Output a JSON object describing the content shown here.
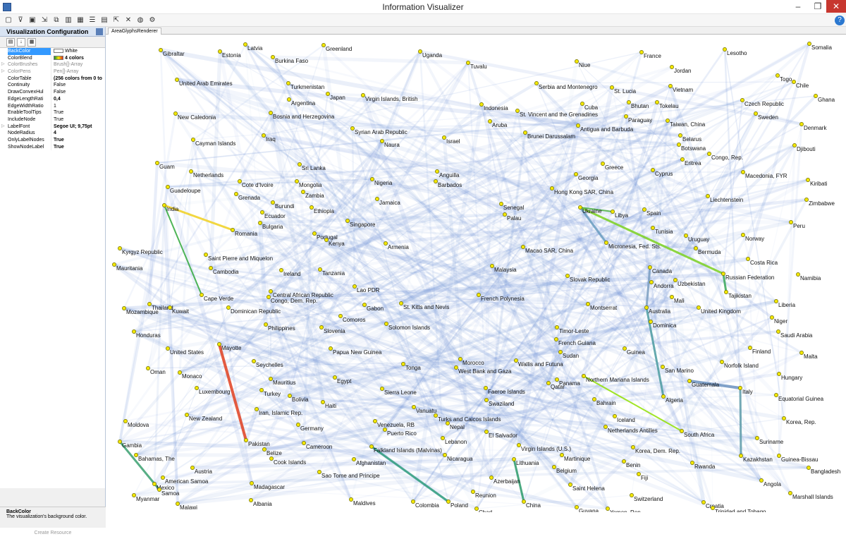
{
  "window": {
    "title": "Information Visualizer",
    "minimize": "–",
    "maximize": "❐",
    "close": "✕"
  },
  "toolbar": {
    "icons": [
      "new-icon",
      "filter-icon",
      "save-icon",
      "import-icon",
      "copy-icon",
      "chart-icon",
      "grid-icon",
      "list-icon",
      "layout-icon",
      "export-icon",
      "delete-icon",
      "globe-icon",
      "settings-icon",
      "help-icon"
    ]
  },
  "panel": {
    "title": "Visualization Configuration",
    "properties": [
      {
        "name": "BackColor",
        "value": "White",
        "swatch": "#ffffff",
        "selected": true
      },
      {
        "name": "ColorBlend",
        "value": "4 colors",
        "swatch": "gradient",
        "bold": true
      },
      {
        "name": "ColorBrushes",
        "value": "Brush[]-Array",
        "expander": true,
        "greyed": true
      },
      {
        "name": "ColorPens",
        "value": "Pen[]-Array",
        "expander": true,
        "greyed": true
      },
      {
        "name": "ColorTable",
        "value": "(256 colors from 0 to",
        "bold": true
      },
      {
        "name": "Continuity",
        "value": "False"
      },
      {
        "name": "DrawConvexHul",
        "value": "False"
      },
      {
        "name": "EdgeLengthRati",
        "value": "0,4",
        "bold": true
      },
      {
        "name": "EdgeWidthRatio",
        "value": "1"
      },
      {
        "name": "EnableToolTips",
        "value": "True"
      },
      {
        "name": "IncludeNode",
        "value": "True"
      },
      {
        "name": "LabelFont",
        "value": "Segoe UI; 9,75pt",
        "expander": true,
        "bold": true
      },
      {
        "name": "NodeRadius",
        "value": "4",
        "bold": true
      },
      {
        "name": "OnlyLabelNodes",
        "value": "True",
        "bold": true
      },
      {
        "name": "ShowNodeLabel",
        "value": "True",
        "bold": true
      }
    ],
    "help_title": "BackColor",
    "help_text": "The visualization's background color.",
    "create_button": "Create Resource"
  },
  "tab": {
    "label": "AreaGlyphsRenderer"
  },
  "nodes": [
    [
      "Gibraltar",
      228,
      71
    ],
    [
      "Latvia",
      348,
      63
    ],
    [
      "Estonia",
      312,
      73
    ],
    [
      "Burkina Faso",
      387,
      81
    ],
    [
      "Greenland",
      459,
      64
    ],
    [
      "Uganda",
      596,
      73
    ],
    [
      "Tuvalu",
      664,
      89
    ],
    [
      "Niue",
      818,
      87
    ],
    [
      "France",
      910,
      74
    ],
    [
      "Lesotho",
      1028,
      70
    ],
    [
      "Somalia",
      1148,
      62
    ],
    [
      "United Arab Emirates",
      251,
      113
    ],
    [
      "Turkmenistan",
      409,
      118
    ],
    [
      "Japan",
      465,
      133
    ],
    [
      "Virgin Islands, British",
      515,
      135
    ],
    [
      "Jordan",
      953,
      95
    ],
    [
      "Serbia and Montenegro",
      761,
      118
    ],
    [
      "St. Lucia",
      868,
      124
    ],
    [
      "Vietnam",
      951,
      122
    ],
    [
      "Togo",
      1103,
      107
    ],
    [
      "Chile",
      1126,
      116
    ],
    [
      "Ghana",
      1157,
      136
    ],
    [
      "Argentina",
      410,
      141
    ],
    [
      "Indonesia",
      683,
      148
    ],
    [
      "Cuba",
      826,
      147
    ],
    [
      "Bhutan",
      892,
      145
    ],
    [
      "Tokelau",
      932,
      145
    ],
    [
      "Czech Republic",
      1053,
      142
    ],
    [
      "Sweden",
      1072,
      161
    ],
    [
      "New Caledonia",
      249,
      161
    ],
    [
      "Bosnia and Herzegovina",
      384,
      160
    ],
    [
      "St. Vincent and the Grenadines",
      734,
      157
    ],
    [
      "Paraguay",
      888,
      165
    ],
    [
      "Taiwan, China",
      947,
      171
    ],
    [
      "Denmark",
      1137,
      176
    ],
    [
      "Syrian Arab Republic",
      500,
      182
    ],
    [
      "Aruba",
      695,
      172
    ],
    [
      "Antigua and Barbuda",
      820,
      178
    ],
    [
      "Brunei Darussalam",
      745,
      188
    ],
    [
      "Belarus",
      965,
      192
    ],
    [
      "Botswana",
      963,
      205
    ],
    [
      "Djibouti",
      1127,
      206
    ],
    [
      "Cayman Islands",
      274,
      198
    ],
    [
      "Iraq",
      374,
      192
    ],
    [
      "Naura",
      542,
      200
    ],
    [
      "Israel",
      630,
      195
    ],
    [
      "Congo, Rep.",
      1006,
      218
    ],
    [
      "Guam",
      223,
      231
    ],
    [
      "Sri Lanka",
      425,
      233
    ],
    [
      "Greece",
      855,
      232
    ],
    [
      "Eritrea",
      968,
      226
    ],
    [
      "Cyprus",
      926,
      241
    ],
    [
      "Netherlands",
      271,
      243
    ],
    [
      "Anguilla",
      620,
      243
    ],
    [
      "Georgia",
      817,
      247
    ],
    [
      "Macedonia, FYR",
      1054,
      244
    ],
    [
      "Kiribati",
      1146,
      255
    ],
    [
      "Cote d'Ivoire",
      340,
      257
    ],
    [
      "Mongolia",
      421,
      257
    ],
    [
      "Nigeria",
      528,
      254
    ],
    [
      "Barbados",
      618,
      257
    ],
    [
      "Guadeloupe",
      238,
      265
    ],
    [
      "Hong Kong SAR, China",
      783,
      267
    ],
    [
      "Zambia",
      430,
      272
    ],
    [
      "Grenada",
      335,
      275
    ],
    [
      "Jamaica",
      535,
      282
    ],
    [
      "Liechtenstein",
      1004,
      278
    ],
    [
      "Zimbabwe",
      1144,
      283
    ],
    [
      "India",
      233,
      291
    ],
    [
      "Burundi",
      387,
      287
    ],
    [
      "Ethiopia",
      442,
      294
    ],
    [
      "Senegal",
      711,
      289
    ],
    [
      "Ukraine",
      823,
      294
    ],
    [
      "Libya",
      869,
      300
    ],
    [
      "Spain",
      914,
      297
    ],
    [
      "Ecuador",
      372,
      301
    ],
    [
      "Palau",
      716,
      304
    ],
    [
      "Bulgaria",
      369,
      316
    ],
    [
      "Singapore",
      493,
      313
    ],
    [
      "Peru",
      1122,
      315
    ],
    [
      "Romania",
      330,
      326
    ],
    [
      "Portugal",
      446,
      331
    ],
    [
      "Tunisia",
      926,
      323
    ],
    [
      "Uruguay",
      973,
      334
    ],
    [
      "Norway",
      1054,
      333
    ],
    [
      "Kenya",
      463,
      340
    ],
    [
      "Armenia",
      547,
      345
    ],
    [
      "Micronesia, Fed. Sts.",
      860,
      344
    ],
    [
      "Bermuda",
      987,
      352
    ],
    [
      "Macao SAR, China",
      742,
      350
    ],
    [
      "Kyrgyz Republic",
      170,
      352
    ],
    [
      "Saint Pierre and Miquelon",
      292,
      361
    ],
    [
      "Costa Rica",
      1061,
      367
    ],
    [
      "Mauritania",
      162,
      375
    ],
    [
      "Cambodia",
      299,
      380
    ],
    [
      "Ireland",
      399,
      383
    ],
    [
      "Tanzania",
      454,
      382
    ],
    [
      "Malaysia",
      698,
      377
    ],
    [
      "Canada",
      922,
      379
    ],
    [
      "Russian Federation",
      1026,
      388
    ],
    [
      "Namibia",
      1132,
      389
    ],
    [
      "Slovak Republic",
      805,
      391
    ],
    [
      "Andorra",
      924,
      400
    ],
    [
      "Uzbekistan",
      958,
      397
    ],
    [
      "Lao PDR",
      503,
      406
    ],
    [
      "Tajikistan",
      1030,
      414
    ],
    [
      "Cape Verde",
      286,
      418
    ],
    [
      "Central African Republic",
      384,
      413
    ],
    [
      "Congo, Dem. Rep.",
      381,
      421
    ],
    [
      "French Polynesia",
      679,
      418
    ],
    [
      "Mali",
      953,
      421
    ],
    [
      "Liberia",
      1101,
      427
    ],
    [
      "Thailand",
      212,
      431
    ],
    [
      "Mozambique",
      176,
      437
    ],
    [
      "Kuwait",
      241,
      436
    ],
    [
      "Dominican Republic",
      324,
      436
    ],
    [
      "Gabon",
      517,
      432
    ],
    [
      "St. Kitts and Nevis",
      569,
      430
    ],
    [
      "Montserrat",
      834,
      431
    ],
    [
      "Australia",
      917,
      436
    ],
    [
      "United Kingdom",
      991,
      436
    ],
    [
      "Comoros",
      483,
      448
    ],
    [
      "Niger",
      1095,
      450
    ],
    [
      "Dominica",
      923,
      456
    ],
    [
      "Honduras",
      190,
      470
    ],
    [
      "Philippines",
      377,
      460
    ],
    [
      "Slovenia",
      456,
      464
    ],
    [
      "Solomon Islands",
      548,
      459
    ],
    [
      "Saudi Arabia",
      1104,
      470
    ],
    [
      "Timor-Leste",
      790,
      464
    ],
    [
      "French Guiana",
      789,
      481
    ],
    [
      "Mayotte",
      311,
      488
    ],
    [
      "United States",
      238,
      494
    ],
    [
      "Papua New Guinea",
      469,
      494
    ],
    [
      "Finland",
      1064,
      493
    ],
    [
      "Sudan",
      795,
      499
    ],
    [
      "Guinea",
      886,
      494
    ],
    [
      "Malta",
      1137,
      500
    ],
    [
      "Seychelles",
      360,
      512
    ],
    [
      "Morocco",
      653,
      509
    ],
    [
      "Wallis and Futuna",
      732,
      511
    ],
    [
      "Norfolk Island",
      1024,
      513
    ],
    [
      "San Marino",
      940,
      520
    ],
    [
      "Tonga",
      572,
      516
    ],
    [
      "West Bank and Gaza",
      647,
      521
    ],
    [
      "Oman",
      210,
      522
    ],
    [
      "Monaco",
      255,
      528
    ],
    [
      "Mauritius",
      384,
      537
    ],
    [
      "Egypt",
      475,
      535
    ],
    [
      "Panama",
      790,
      538
    ],
    [
      "Qatar",
      778,
      543
    ],
    [
      "Northern Mariana Islands",
      828,
      533
    ],
    [
      "Guatemala",
      978,
      540
    ],
    [
      "Italy",
      1050,
      550
    ],
    [
      "Hungary",
      1105,
      530
    ],
    [
      "Luxembourg",
      279,
      550
    ],
    [
      "Turkey",
      371,
      553
    ],
    [
      "Bolivia",
      411,
      561
    ],
    [
      "Sierra Leone",
      542,
      551
    ],
    [
      "Faeroe Islands",
      689,
      550
    ],
    [
      "Algeria",
      941,
      562
    ],
    [
      "Equatorial Guinea",
      1101,
      560
    ],
    [
      "Haiti",
      458,
      570
    ],
    [
      "Bahrain",
      843,
      566
    ],
    [
      "Swaziland",
      690,
      567
    ],
    [
      "Vanuatu",
      587,
      577
    ],
    [
      "Iran, Islamic Rep.",
      364,
      580
    ],
    [
      "New Zealand",
      265,
      588
    ],
    [
      "Turks and Caicos Islands",
      618,
      589
    ],
    [
      "Venezuela, RB",
      532,
      597
    ],
    [
      "Nepal",
      635,
      600
    ],
    [
      "Iceland",
      872,
      590
    ],
    [
      "Netherlands Antilles",
      859,
      605
    ],
    [
      "South Africa",
      967,
      611
    ],
    [
      "Moldova",
      178,
      597
    ],
    [
      "Germany",
      423,
      602
    ],
    [
      "Puerto Rico",
      546,
      609
    ],
    [
      "Korea, Rep.",
      1112,
      593
    ],
    [
      "Lebanon",
      628,
      621
    ],
    [
      "El Salvador",
      690,
      612
    ],
    [
      "Suriname",
      1074,
      621
    ],
    [
      "Gambia",
      170,
      626
    ],
    [
      "Pakistan",
      349,
      624
    ],
    [
      "Cameroon",
      431,
      628
    ],
    [
      "Falkland Islands (Malvinas)",
      527,
      633
    ],
    [
      "Nicaragua",
      631,
      645
    ],
    [
      "Virgin Islands (U.S.)",
      736,
      631
    ],
    [
      "Belize",
      375,
      637
    ],
    [
      "Cook Islands",
      385,
      650
    ],
    [
      "Afghanistan",
      502,
      651
    ],
    [
      "Martinique",
      797,
      645
    ],
    [
      "Lithuania",
      729,
      651
    ],
    [
      "Korea, Dem. Rep.",
      898,
      634
    ],
    [
      "Kazakhstan",
      1051,
      646
    ],
    [
      "Guinea-Bissau",
      1105,
      646
    ],
    [
      "Bangladesh",
      1147,
      663
    ],
    [
      "Bahamas, The",
      193,
      645
    ],
    [
      "Benin",
      885,
      654
    ],
    [
      "Rwanda",
      982,
      656
    ],
    [
      "Belgium",
      786,
      662
    ],
    [
      "Austria",
      273,
      663
    ],
    [
      "Sao Tome and Principe",
      453,
      669
    ],
    [
      "Fiji",
      906,
      672
    ],
    [
      "American Samoa",
      231,
      677
    ],
    [
      "Mexico",
      219,
      686
    ],
    [
      "Samoa",
      226,
      694
    ],
    [
      "Azerbaijan",
      697,
      677
    ],
    [
      "Saint Helena",
      809,
      687
    ],
    [
      "Angola",
      1080,
      681
    ],
    [
      "Madagascar",
      357,
      685
    ],
    [
      "Reunion",
      671,
      697
    ],
    [
      "Myanmar",
      190,
      702
    ],
    [
      "Marshall Islands",
      1121,
      699
    ],
    [
      "Malawi",
      252,
      714
    ],
    [
      "Albania",
      356,
      709
    ],
    [
      "Maldives",
      498,
      708
    ],
    [
      "Colombia",
      586,
      711
    ],
    [
      "Poland",
      636,
      711
    ],
    [
      "China",
      743,
      711
    ],
    [
      "Switzerland",
      896,
      702
    ],
    [
      "Croatia",
      998,
      712
    ],
    [
      "Chad",
      676,
      721
    ],
    [
      "Guyana",
      818,
      719
    ],
    [
      "Yemen, Rep.",
      862,
      721
    ],
    [
      "Trinidad and Tobago",
      1011,
      720
    ]
  ],
  "colors": {
    "accent": "#3399ff",
    "edge": "#6a8fd6",
    "node_fill": "#f2e600",
    "node_stroke": "#6b6b00"
  }
}
